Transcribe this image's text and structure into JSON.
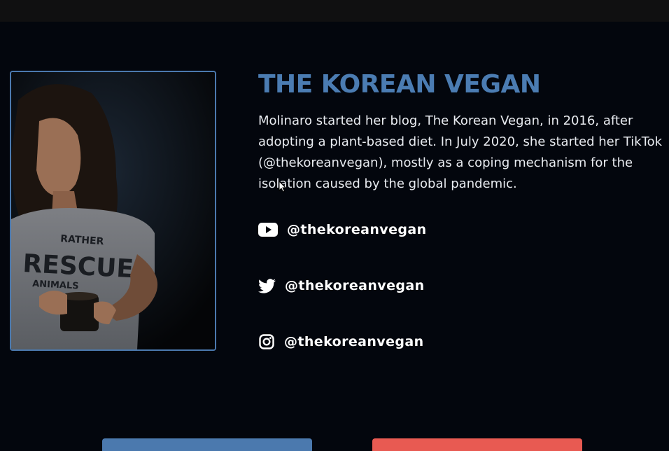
{
  "section": {
    "title": "THE KOREAN VEGAN",
    "description": "Molinaro started her blog, The Korean Vegan, in 2016, after adopting a plant-based diet. In July 2020, she started her TikTok (@thekoreanvegan), mostly as a coping mechanism for the isolation caused by the global pandemic."
  },
  "photo": {
    "shirt_text_line1": "RATHER",
    "shirt_text_line2": "RESCUE",
    "shirt_text_line3": "ANIMALS"
  },
  "social": [
    {
      "platform": "youtube",
      "icon": "youtube-icon",
      "handle": "@thekoreanvegan"
    },
    {
      "platform": "twitter",
      "icon": "twitter-icon",
      "handle": "@thekoreanvegan"
    },
    {
      "platform": "instagram",
      "icon": "instagram-icon",
      "handle": "@thekoreanvegan"
    }
  ],
  "colors": {
    "background": "#03060d",
    "accent": "#4b7cb2",
    "button_secondary": "#e85a52"
  }
}
